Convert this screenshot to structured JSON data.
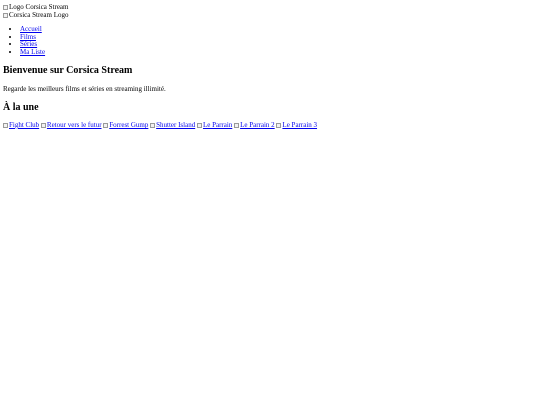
{
  "header": {
    "logo_alt_1": "Logo Corsica Stream",
    "logo_alt_2": "Corsica Stream Logo"
  },
  "nav": {
    "items": [
      {
        "label": "Accueil"
      },
      {
        "label": "Films"
      },
      {
        "label": "Séries"
      },
      {
        "label": "Ma Liste"
      }
    ]
  },
  "main": {
    "title": "Bienvenue sur Corsica Stream",
    "tagline": "Regarde les meilleurs films et séries en streaming illimité.",
    "featured_heading": "À la une",
    "featured": [
      {
        "alt": "Fight Club"
      },
      {
        "alt": "Retour vers le futur"
      },
      {
        "alt": "Forrest Gump"
      },
      {
        "alt": "Shutter Island"
      },
      {
        "alt": "Le Parrain"
      },
      {
        "alt": "Le Parrain 2"
      },
      {
        "alt": "Le Parrain 3"
      }
    ]
  },
  "colors": {
    "link": "#0000ee",
    "text": "#000000",
    "background": "#ffffff"
  }
}
